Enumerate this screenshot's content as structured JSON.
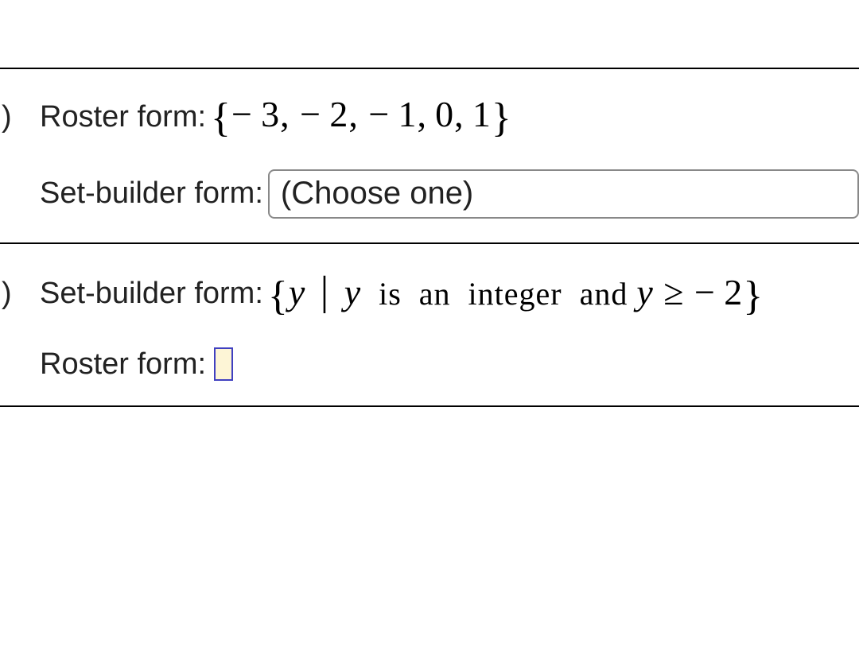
{
  "part_a": {
    "marker": ")",
    "roster_label": "Roster form:",
    "roster_set": "{−3, −2, −1, 0, 1}",
    "setbuilder_label": "Set-builder form:",
    "dropdown_placeholder": "(Choose one)"
  },
  "part_b": {
    "marker": ")",
    "setbuilder_label": "Set-builder form:",
    "setbuilder_open": "{",
    "setbuilder_var1": "y",
    "setbuilder_pipe": "|",
    "setbuilder_var2": "y",
    "setbuilder_text": " is an integer and ",
    "setbuilder_var3": "y",
    "setbuilder_cond": " ≥ −2",
    "setbuilder_close": "}",
    "roster_label": "Roster form:"
  }
}
